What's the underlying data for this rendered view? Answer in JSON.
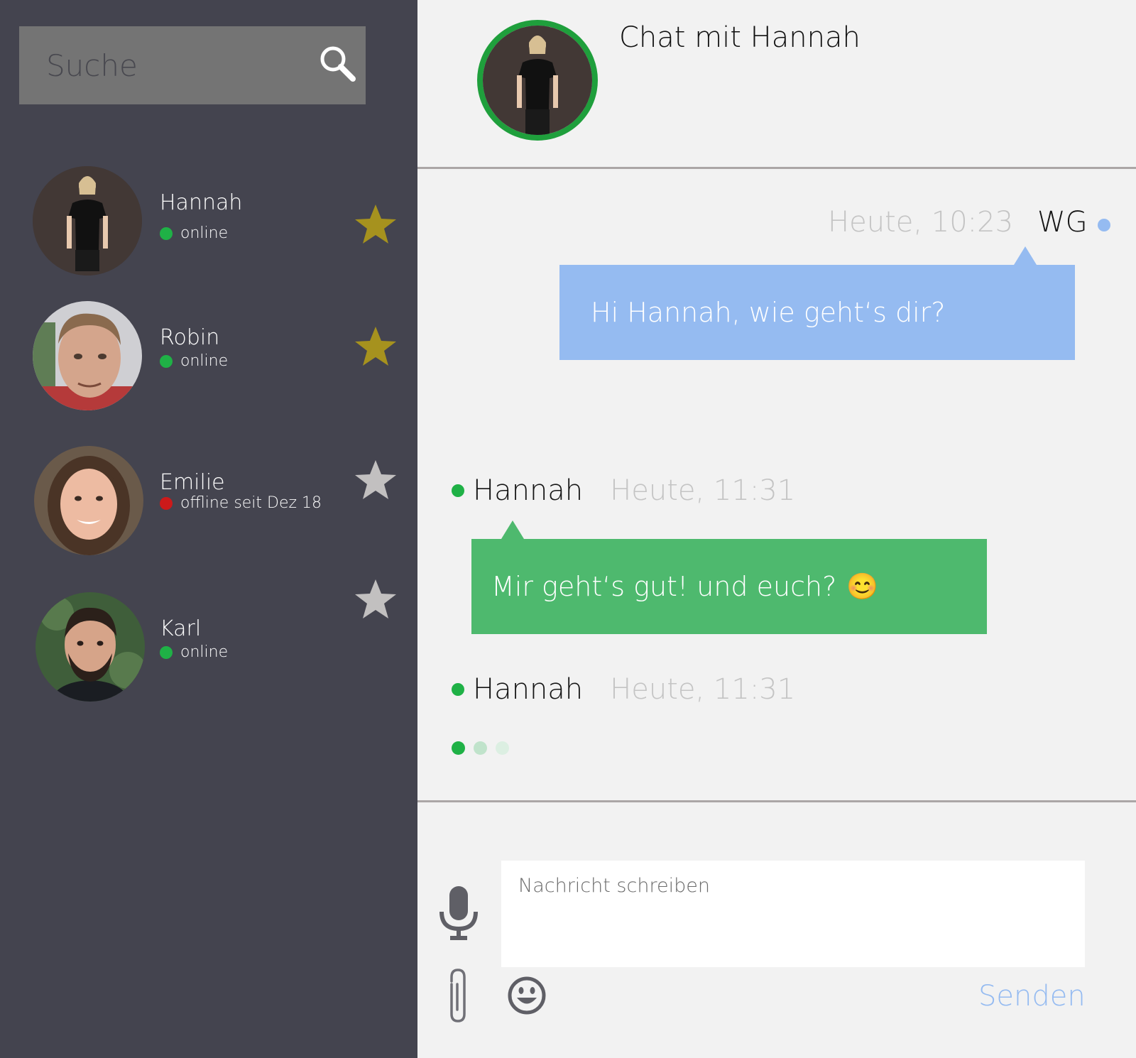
{
  "colors": {
    "sidebar_bg": "#44444f",
    "search_bg": "#747474",
    "online": "#1fb146",
    "offline": "#cc1a1a",
    "star_favorite": "#a6921e",
    "star_default": "#c2c0c0",
    "bubble_outgoing": "#95bbf1",
    "bubble_incoming": "#4eb96e",
    "accent_blue": "#95bbf1"
  },
  "search": {
    "placeholder": "Suche",
    "icon": "search-icon"
  },
  "contacts": [
    {
      "name": "Hannah",
      "status": "online",
      "online": true,
      "favorite": true
    },
    {
      "name": "Robin",
      "status": "online",
      "online": true,
      "favorite": true
    },
    {
      "name": "Emilie",
      "status": "offline seit Dez 18",
      "online": false,
      "favorite": false
    },
    {
      "name": "Karl",
      "status": "online",
      "online": true,
      "favorite": false
    }
  ],
  "chat": {
    "title": "Chat mit Hannah",
    "messages": [
      {
        "direction": "outgoing",
        "sender": "WG",
        "time": "Heute, 10:23",
        "text": "Hi Hannah, wie geht‘s dir?"
      },
      {
        "direction": "incoming",
        "sender": "Hannah",
        "time": "Heute, 11:31",
        "text": "Mir geht‘s gut! und euch?",
        "emoji": "😊"
      }
    ],
    "typing": {
      "sender": "Hannah",
      "time": "Heute, 11:31"
    }
  },
  "composer": {
    "placeholder": "Nachricht schreiben",
    "send_label": "Senden",
    "icons": [
      "microphone-icon",
      "paperclip-icon",
      "emoji-icon"
    ]
  }
}
